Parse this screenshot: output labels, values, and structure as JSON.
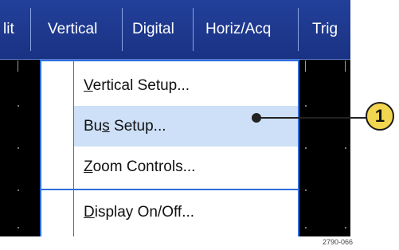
{
  "menubar": {
    "items": [
      {
        "label": "lit"
      },
      {
        "label": "Vertical"
      },
      {
        "label": "Digital"
      },
      {
        "label": "Horiz/Acq"
      },
      {
        "label": "Trig"
      }
    ]
  },
  "dropdown": {
    "items": [
      {
        "label": "Vertical Setup...",
        "mnemonic": "V",
        "rest": "ertical Setup..."
      },
      {
        "label": "Bus Setup...",
        "pre": "Bu",
        "mnemonic": "s",
        "rest": " Setup..."
      },
      {
        "label": "Zoom Controls...",
        "mnemonic": "Z",
        "rest": "oom Controls..."
      },
      {
        "label": "Display On/Off...",
        "mnemonic": "D",
        "rest": "isplay On/Off..."
      }
    ],
    "highlighted_index": 1
  },
  "callout": {
    "number": "1",
    "color": "#f2d64f"
  },
  "figure_code": "2790-066",
  "colors": {
    "menubar": "#1a3283",
    "accent": "#2e6edb",
    "highlight": "#cde0f7"
  }
}
